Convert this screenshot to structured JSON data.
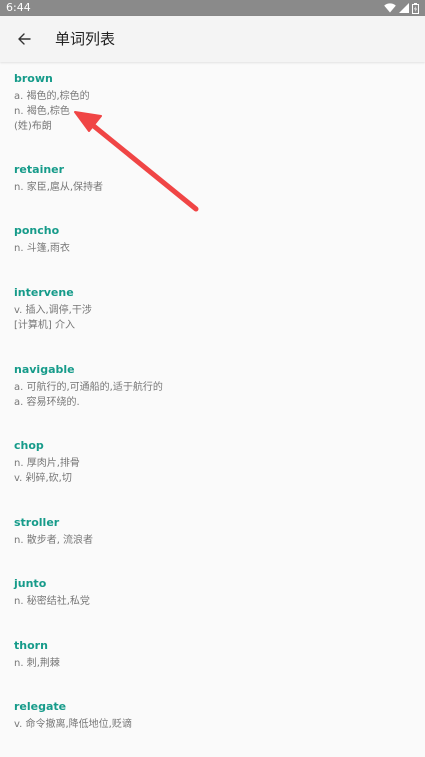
{
  "status_bar": {
    "time": "6:44"
  },
  "app_bar": {
    "title": "单词列表"
  },
  "colors": {
    "word": "#169b8a",
    "meaning": "#777777",
    "arrow": "#f04545"
  },
  "words": [
    {
      "word": "brown",
      "meanings": [
        "a. 褐色的,棕色的",
        "n. 褐色,棕色",
        "(姓)布朗"
      ]
    },
    {
      "word": "retainer",
      "meanings": [
        "n. 家臣,扈从,保持者"
      ]
    },
    {
      "word": "poncho",
      "meanings": [
        "n. 斗篷,雨衣"
      ]
    },
    {
      "word": "intervene",
      "meanings": [
        "v. 插入,调停,干涉",
        "[计算机] 介入"
      ]
    },
    {
      "word": "navigable",
      "meanings": [
        "a. 可航行的,可通船的,适于航行的",
        "a. 容易环绕的."
      ]
    },
    {
      "word": "chop",
      "meanings": [
        "n. 厚肉片,排骨",
        "v. 剁碎,砍,切"
      ]
    },
    {
      "word": "stroller",
      "meanings": [
        "n. 散步者, 流浪者"
      ]
    },
    {
      "word": "junto",
      "meanings": [
        "n. 秘密结社,私党"
      ]
    },
    {
      "word": "thorn",
      "meanings": [
        "n. 刺,荆棘"
      ]
    },
    {
      "word": "relegate",
      "meanings": [
        "v. 命令撤离,降低地位,贬谪"
      ]
    }
  ]
}
